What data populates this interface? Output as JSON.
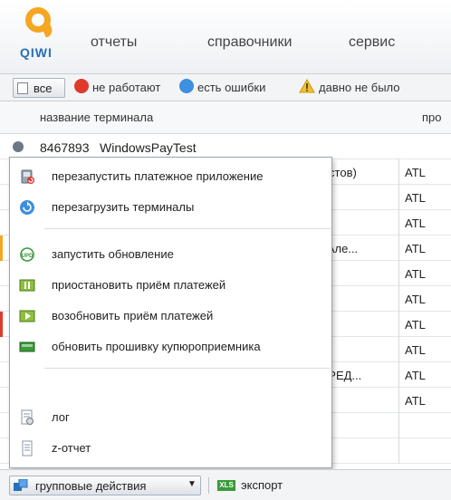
{
  "header": {
    "logo_text": "QIWI",
    "menu": [
      "отчеты",
      "справочники",
      "сервис"
    ]
  },
  "filters": {
    "all_label": "все",
    "not_working": "не работают",
    "has_errors": "есть ошибки",
    "long_ago": "давно не было"
  },
  "table": {
    "col_name": "название терминала",
    "col_partial": "про",
    "first_row": {
      "id": "8467893",
      "name": "WindowsPayTest"
    },
    "rows": [
      {
        "text": "тестов)",
        "code": "ATL"
      },
      {
        "text": "",
        "code": "ATL"
      },
      {
        "text": "",
        "code": "ATL"
      },
      {
        "text": "а Але...",
        "code": "ATL"
      },
      {
        "text": "",
        "code": "ATL"
      },
      {
        "text": "А)",
        "code": "ATL"
      },
      {
        "text": "",
        "code": "ATL"
      },
      {
        "text": "",
        "code": "ATL"
      },
      {
        "text": "Е РЕД...",
        "code": "ATL"
      },
      {
        "text": "",
        "code": "ATL"
      }
    ]
  },
  "context_menu": {
    "items": [
      {
        "label": "перезапустить платежное приложение",
        "icon": "restart-app-icon"
      },
      {
        "label": "перезагрузить терминалы",
        "icon": "reboot-icon"
      },
      {
        "label": "запустить обновление",
        "icon": "update-icon"
      },
      {
        "label": "приостановить приём платежей",
        "icon": "pause-icon"
      },
      {
        "label": "возобновить приём платежей",
        "icon": "resume-icon"
      },
      {
        "label": "обновить прошивку купюроприемника",
        "icon": "firmware-icon"
      },
      {
        "label": "лог",
        "icon": "log-icon"
      },
      {
        "label": "z-отчет",
        "icon": "z-report-icon"
      }
    ]
  },
  "bottom": {
    "group_actions": "групповые действия",
    "export": "экспорт",
    "xls_badge": "XLS"
  },
  "colors": {
    "brand_orange": "#f5a623",
    "brand_blue": "#2670b8",
    "error_red": "#e0392b",
    "info_blue": "#3d8fe0",
    "warn_yellow": "#f2c02e"
  }
}
